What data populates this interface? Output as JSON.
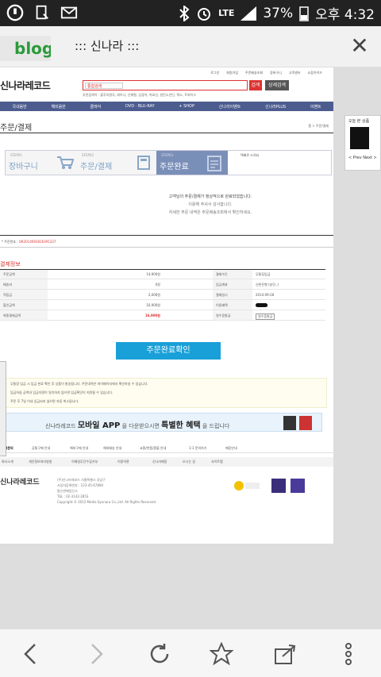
{
  "status": {
    "lte": "LTE",
    "battery": "37%",
    "time": "오후 4:32"
  },
  "browser": {
    "tab_label": "blog",
    "page_title": "::: 신나라 :::"
  },
  "site": {
    "toplinks": [
      "로그인",
      "회원가입",
      "주문배송조회",
      "장바구니",
      "고객센터",
      "쇼핑가이드"
    ],
    "logo": "신나라레코드",
    "search_category": "통합검색",
    "search_btn": "검색",
    "detail_btn": "상세검색",
    "popular": "추천검색어 : 불후의명곡, 레이나, 신해철, 김광석, 박효신, 방탄소년단, 엑소, 트와이스",
    "nav": [
      "국내음반",
      "해외음반",
      "클래식",
      "DVD · BLU-RAY",
      "+ SHOP",
      "신나라이벤트",
      "신나라PLUS",
      "이벤트"
    ],
    "heading": "주문/결제",
    "breadcrumb": "홈 > 주문/결제",
    "steps": [
      {
        "label": "STEP01",
        "name": "장바구니"
      },
      {
        "label": "STEP02",
        "name": "주문/결제"
      },
      {
        "label": "STEP03",
        "name": "주문완료"
      }
    ],
    "step_note": "택배로 드려요",
    "order_note": [
      "고객님의 주문/결제가 정상적으로 완료되었습니다.",
      "이용해 주셔서 감사합니다.",
      "자세한 주문 내역은 주문배송조회에서 확인하세요."
    ],
    "order_no_label": "* 주문번호 :",
    "order_no": "OK2014092816391337",
    "pay_heading": "결제정보",
    "pay_left": [
      {
        "k": "주문금액",
        "v": "14,900원"
      },
      {
        "k": "배송비",
        "v": "0원"
      },
      {
        "k": "적립금",
        "v": "2,000원"
      },
      {
        "k": "할인금액",
        "v": "16,900원"
      },
      {
        "k": "최종결제금액",
        "v": "16,900원"
      }
    ],
    "pay_right": [
      {
        "k": "결제수단",
        "v": "무통장입금"
      },
      {
        "k": "입금계좌",
        "v": "신한은행 (송민..)"
      },
      {
        "k": "결제일시",
        "v": "2014-09-28"
      },
      {
        "k": "이용혜택",
        "v": "■■■■"
      },
      {
        "k": "영수증발급",
        "v": "영수증발급"
      }
    ],
    "confirm_btn": "주문완료확인",
    "notices": [
      "무통장 입금 시 입금 완료 확인 후 상품이 발송됩니다. 주문내역은 마이페이지에서 확인하실 수 있습니다.",
      "입금하실 금액과 입금자명이 일치하지 않으면 입금확인이 지연될 수 있습니다.",
      "주문 후 7일 이내 입금되지 않으면 자동 취소됩니다."
    ],
    "banner_pre": "신나라레코드",
    "banner_app": "모바일 APP",
    "banner_mid": "을 다운받으시면",
    "banner_hl": "특별한 혜택",
    "banner_post": "을 드립니다",
    "footnav": [
      "고객문의",
      "공통구매 안내",
      "해외구매 안내",
      "해외배송 안내",
      "교환/반품/환불 안내",
      "1:1 문의하기",
      "매장안내"
    ],
    "footlinks": [
      "회사소개",
      "개인정보처리방침",
      "이메일무단수집거부",
      "이용약관",
      "신나라매장",
      "오시는 길",
      "사이트맵"
    ],
    "foot_logo": "신나라레코드",
    "foot_addr": [
      "(주)신나라레코드 서울특별시 강남구",
      "사업자등록번호 : 123-45-67890",
      "통신판매업신고",
      "TEL : 02-3142-2853",
      "Copyright © 2012 Media Synnara Co.,Ltd. All Rights Reserved."
    ],
    "side_title": "오늘 본 상품",
    "side_pager": "< Prev Next >"
  }
}
